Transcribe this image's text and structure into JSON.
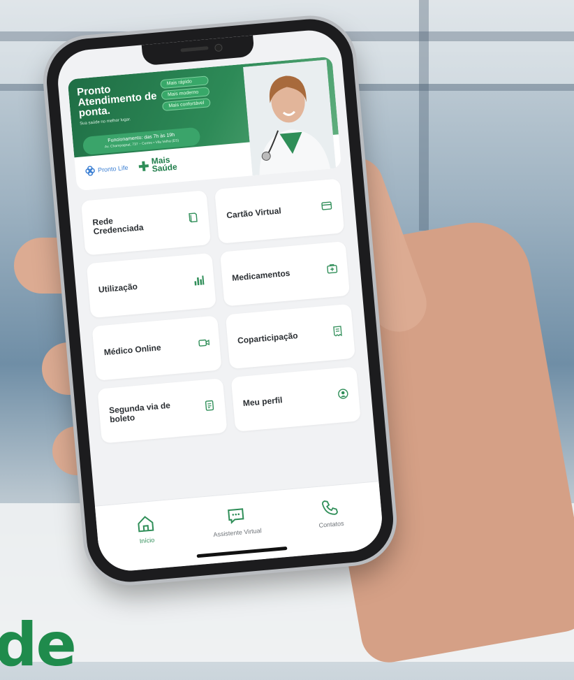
{
  "banner": {
    "title": "Pronto Atendimento de ponta.",
    "subtitle": "Sua saúde no melhor lugar.",
    "pills": [
      "Mais rápido",
      "Mais moderno",
      "Mais confortável"
    ],
    "hours": "Funcionamento: das 7h às 19h",
    "hours_detail": "Av. Champagnat, 737 – Centro • Vila Velha (ES)",
    "logo1": "Pronto Life",
    "logo2": "Mais Saúde"
  },
  "menu": [
    {
      "label": "Rede Credenciada",
      "icon": "book-icon"
    },
    {
      "label": "Cartão Virtual",
      "icon": "card-icon"
    },
    {
      "label": "Utilização",
      "icon": "bar-chart-icon"
    },
    {
      "label": "Medicamentos",
      "icon": "medical-kit-icon"
    },
    {
      "label": "Médico Online",
      "icon": "video-icon"
    },
    {
      "label": "Coparticipação",
      "icon": "receipt-icon"
    },
    {
      "label": "Segunda via de boleto",
      "icon": "document-icon"
    },
    {
      "label": "Meu perfil",
      "icon": "user-icon"
    }
  ],
  "tabs": [
    {
      "label": "Início",
      "icon": "home-icon"
    },
    {
      "label": "Assistente Virtual",
      "icon": "chat-icon"
    },
    {
      "label": "Contatos",
      "icon": "phone-icon"
    }
  ],
  "colors": {
    "accent": "#2f8e58",
    "banner": "#1f6e45"
  },
  "bottom_text": "de"
}
